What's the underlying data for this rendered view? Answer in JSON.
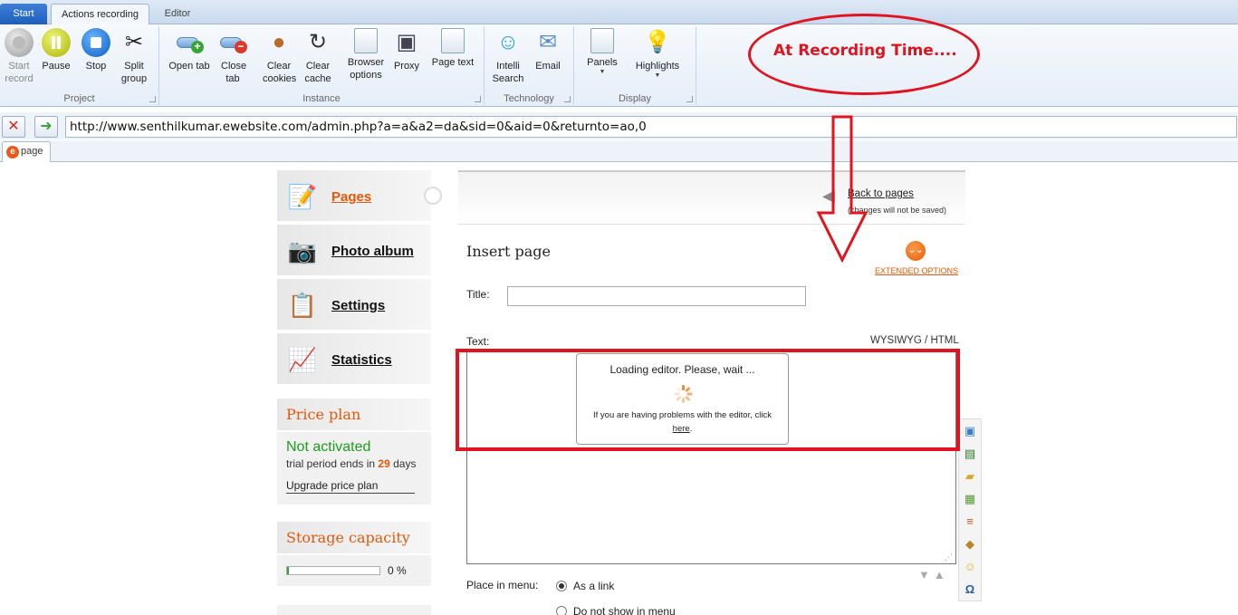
{
  "ribbon": {
    "tabs": [
      "Start",
      "Actions recording",
      "Editor"
    ],
    "project": {
      "label": "Project",
      "buttons": [
        {
          "label": "Start record",
          "icon": "record-icon",
          "enabled": false
        },
        {
          "label": "Pause",
          "icon": "pause-icon",
          "enabled": true
        },
        {
          "label": "Stop",
          "icon": "stop-icon",
          "enabled": true
        },
        {
          "label": "Split group",
          "icon": "scissors-icon",
          "enabled": true
        }
      ]
    },
    "instance": {
      "label": "Instance",
      "buttons": [
        {
          "label": "Open tab",
          "icon": "open-tab-icon"
        },
        {
          "label": "Close tab",
          "icon": "close-tab-icon"
        },
        {
          "label": "Clear cookies",
          "icon": "cookie-icon"
        },
        {
          "label": "Clear cache",
          "icon": "cache-icon"
        },
        {
          "label": "Browser options",
          "icon": "browser-options-icon"
        },
        {
          "label": "Proxy",
          "icon": "proxy-icon"
        },
        {
          "label": "Page text",
          "icon": "page-text-icon"
        }
      ]
    },
    "technology": {
      "label": "Technology",
      "buttons": [
        {
          "label": "Intelli Search",
          "icon": "intelli-search-icon"
        },
        {
          "label": "Email",
          "icon": "email-icon"
        }
      ]
    },
    "display": {
      "label": "Display",
      "buttons": [
        {
          "label": "Panels",
          "icon": "panels-icon"
        },
        {
          "label": "Highlights",
          "icon": "lightbulb-icon"
        }
      ]
    }
  },
  "annotation": {
    "text": "At Recording Time...."
  },
  "address": {
    "url": "http://www.senthilkumar.ewebsite.com/admin.php?a=a&a2=da&sid=0&aid=0&returnto=ao,0"
  },
  "page_tab": {
    "label": "page"
  },
  "sidebar": {
    "items": [
      {
        "label": "Pages",
        "icon": "pages-icon"
      },
      {
        "label": "Photo album",
        "icon": "camera-icon"
      },
      {
        "label": "Settings",
        "icon": "checklist-icon"
      },
      {
        "label": "Statistics",
        "icon": "chart-icon"
      }
    ],
    "price_plan": {
      "title": "Price plan",
      "status": "Not activated",
      "trial_prefix": "trial period ends in",
      "trial_days": "29",
      "trial_suffix": "days",
      "upgrade": "Upgrade price plan"
    },
    "storage": {
      "title": "Storage capacity",
      "percent_text": "0 %",
      "percent_value": 0.02
    }
  },
  "main": {
    "back_link": "Back to pages",
    "back_note": "(changes will not be saved)",
    "insert_title": "Insert page",
    "extended_options": "EXTENDED OPTIONS",
    "title_label": "Title:",
    "title_value": "",
    "text_label": "Text:",
    "wysiwyg": "WYSIWYG / HTML",
    "loading_title": "Loading editor. Please, wait ...",
    "loading_help": "If you are having problems with the editor, click",
    "loading_here": "here",
    "place_label": "Place in menu:",
    "place_options": [
      "As a link",
      "Do not show in menu"
    ]
  },
  "colors": {
    "accent": "#e4580a",
    "annotation": "#e0141e",
    "success": "#1b9d1b"
  }
}
